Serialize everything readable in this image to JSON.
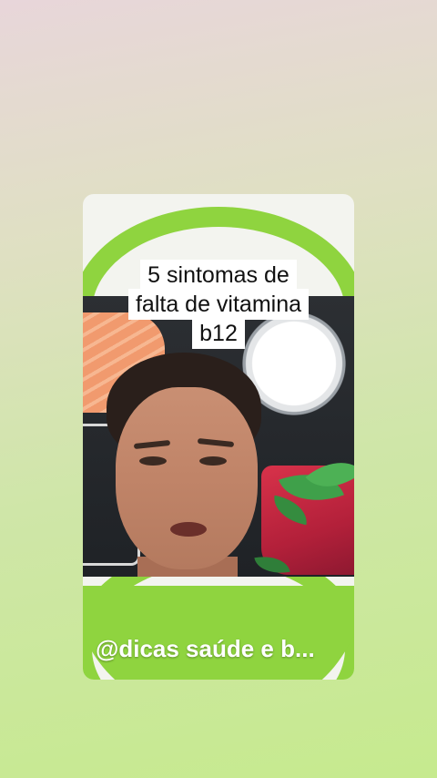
{
  "post": {
    "title_lines": [
      "5 sintomas de",
      "falta de vitamina",
      "b12"
    ],
    "handle": "@dicas saúde e b..."
  },
  "colors": {
    "accent_green": "#8fd43f",
    "caption_bg": "#ffffff"
  }
}
